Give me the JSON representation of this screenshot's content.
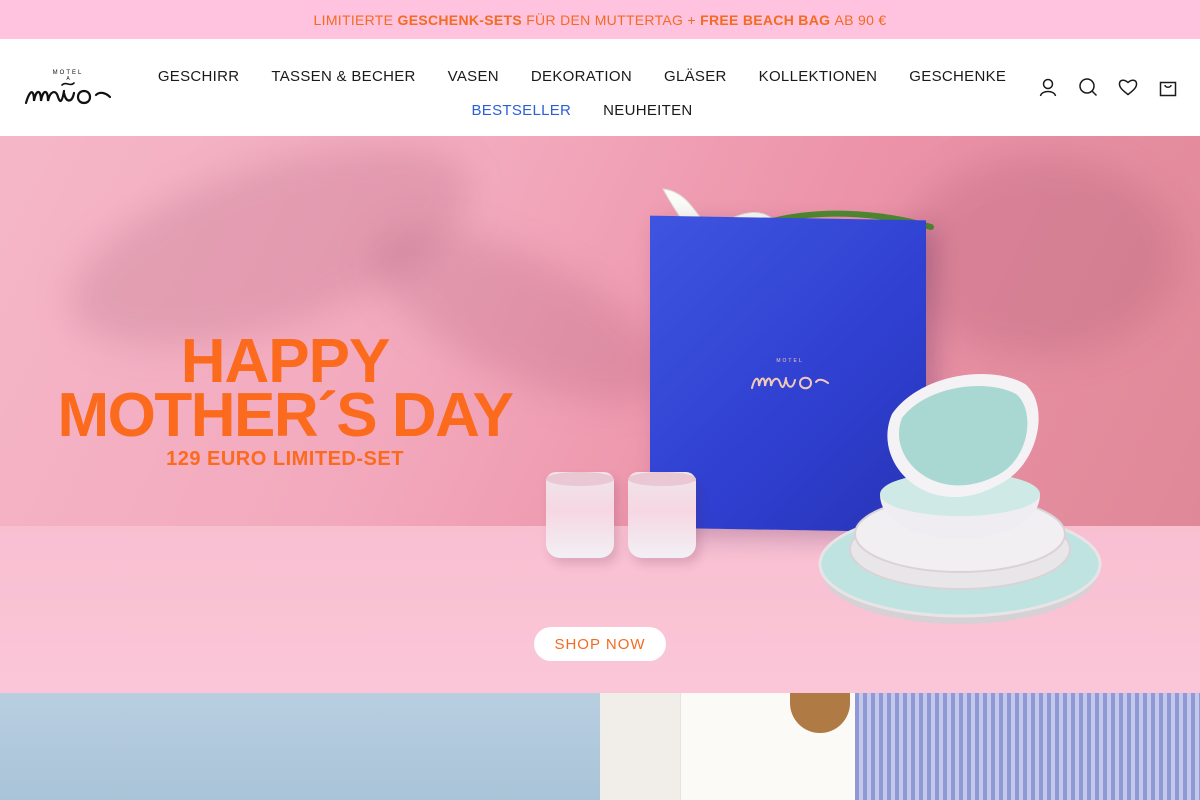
{
  "announcement": {
    "part1": "LIMITIERTE ",
    "bold1": "GESCHENK-SETS",
    "part2": " FÜR DEN MUTTERTAG + ",
    "bold2": "FREE BEACH BAG",
    "part3": " AB 90 €"
  },
  "brand": {
    "logo_small": "MOTEL A",
    "logo_main": "Miio"
  },
  "nav": {
    "row1": [
      "GESCHIRR",
      "TASSEN & BECHER",
      "VASEN",
      "DEKORATION",
      "GLÄSER",
      "KOLLEKTIONEN",
      "GESCHENKE"
    ],
    "row2": [
      "BESTSELLER",
      "NEUHEITEN"
    ],
    "active": "BESTSELLER"
  },
  "header_icons": [
    "account-icon",
    "search-icon",
    "wishlist-heart-icon",
    "cart-bag-icon"
  ],
  "hero": {
    "line1": "HAPPY",
    "line2": "MOTHER´S DAY",
    "line3": "129 EURO LIMITED-SET",
    "cta": "SHOP NOW"
  },
  "colors": {
    "announcement_bg": "#ffc2df",
    "accent_orange": "#f36b21",
    "active_nav": "#2a5fd6",
    "box_blue": "#3347d6"
  }
}
